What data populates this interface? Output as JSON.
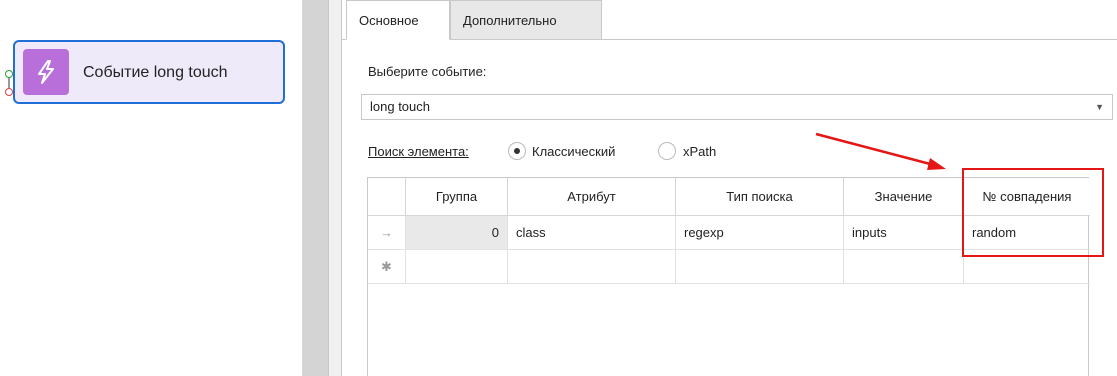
{
  "node": {
    "label": "Событие long touch",
    "icon": "lightning-icon",
    "icon_color": "#b86fd9",
    "border_color": "#1f6fd6"
  },
  "tabs": [
    {
      "label": "Основное",
      "active": true
    },
    {
      "label": "Дополнительно",
      "active": false
    }
  ],
  "event": {
    "label": "Выберите событие:",
    "value": "long touch"
  },
  "search": {
    "label": "Поиск элемента:",
    "options": [
      {
        "label": "Классический",
        "selected": true
      },
      {
        "label": "xPath",
        "selected": false
      }
    ]
  },
  "grid": {
    "columns": [
      "Группа",
      "Атрибут",
      "Тип поиска",
      "Значение",
      "№ совпадения"
    ],
    "rows": [
      {
        "indicator": "→",
        "group": "0",
        "attribute": "class",
        "search_type": "regexp",
        "value": "inputs",
        "match_no": "random"
      },
      {
        "indicator": "✱",
        "group": "",
        "attribute": "",
        "search_type": "",
        "value": "",
        "match_no": ""
      }
    ]
  },
  "annotation": {
    "color": "#e41616"
  }
}
